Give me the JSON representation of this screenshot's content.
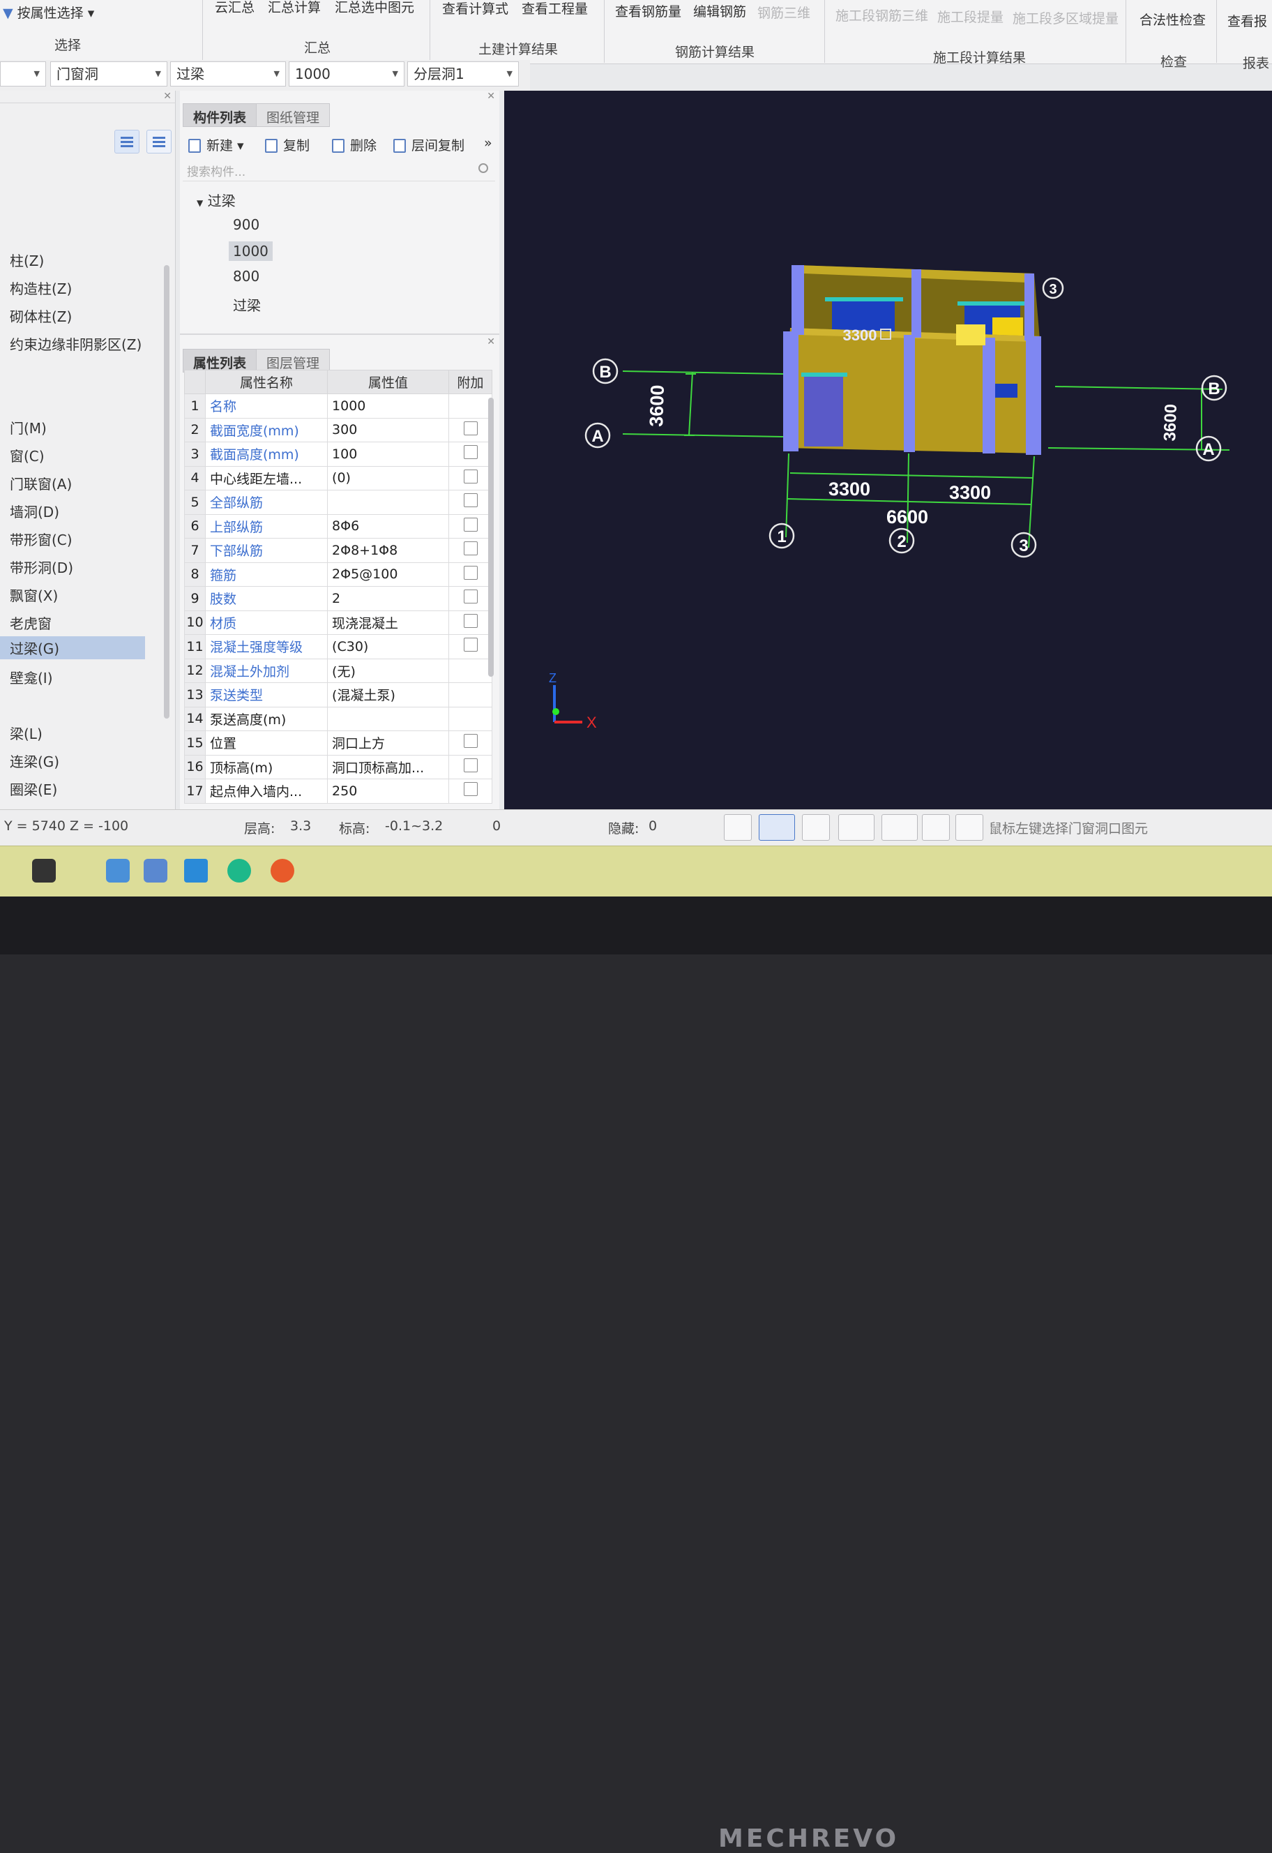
{
  "ribbon": {
    "select_by_attr": "按属性选择",
    "select_group": "选择",
    "cloud_summary": "云汇总",
    "summary_calc": "汇总计算",
    "summary_selected": "汇总选中图元",
    "summary_group": "汇总",
    "view_formula": "查看计算式",
    "view_quantity": "查看工程量",
    "civil_group": "土建计算结果",
    "view_rebar_qty": "查看钢筋量",
    "edit_rebar": "编辑钢筋",
    "rebar_3d": "钢筋三维",
    "rebar_group": "钢筋计算结果",
    "stage_rebar_3d": "施工段钢筋三维",
    "stage_qty": "施工段提量",
    "stage_multi_qty": "施工段多区域提量",
    "stage_group": "施工段计算结果",
    "legality_check": "合法性检查",
    "check_group": "检查",
    "view_report": "查看报",
    "report_group": "报表"
  },
  "filters": {
    "category": "门窗洞",
    "type": "过梁",
    "name": "1000",
    "floor": "分层洞1"
  },
  "left_tree": {
    "items": [
      "柱(Z)",
      "构造柱(Z)",
      "砌体柱(Z)",
      "约束边缘非阴影区(Z)",
      "门(M)",
      "窗(C)",
      "门联窗(A)",
      "墙洞(D)",
      "带形窗(C)",
      "带形洞(D)",
      "飘窗(X)",
      "老虎窗",
      "过梁(G)",
      "壁龛(I)",
      "梁(L)",
      "连梁(G)",
      "圈梁(E)"
    ],
    "selected": "过梁(G)"
  },
  "component_panel": {
    "tabs": [
      "构件列表",
      "图纸管理"
    ],
    "toolbar": {
      "new": "新建",
      "copy": "复制",
      "delete": "删除",
      "floor_copy": "层间复制"
    },
    "search_placeholder": "搜索构件...",
    "group": "过梁",
    "items": [
      "900",
      "1000",
      "800",
      "过梁"
    ],
    "selected": "1000"
  },
  "property_panel": {
    "tabs": [
      "属性列表",
      "图层管理"
    ],
    "headers": [
      "属性名称",
      "属性值",
      "附加"
    ],
    "rows": [
      {
        "n": "1",
        "name": "名称",
        "value": "1000",
        "blue": true,
        "check": false
      },
      {
        "n": "2",
        "name": "截面宽度(mm)",
        "value": "300",
        "blue": true,
        "check": true
      },
      {
        "n": "3",
        "name": "截面高度(mm)",
        "value": "100",
        "blue": true,
        "check": true
      },
      {
        "n": "4",
        "name": "中心线距左墙...",
        "value": "(0)",
        "blue": false,
        "check": true
      },
      {
        "n": "5",
        "name": "全部纵筋",
        "value": "",
        "blue": true,
        "check": true
      },
      {
        "n": "6",
        "name": "上部纵筋",
        "value": "8Φ6",
        "blue": true,
        "check": true
      },
      {
        "n": "7",
        "name": "下部纵筋",
        "value": "2Φ8+1Φ8",
        "blue": true,
        "check": true
      },
      {
        "n": "8",
        "name": "箍筋",
        "value": "2Φ5@100",
        "blue": true,
        "check": true
      },
      {
        "n": "9",
        "name": "肢数",
        "value": "2",
        "blue": true,
        "check": true
      },
      {
        "n": "10",
        "name": "材质",
        "value": "现浇混凝土",
        "blue": true,
        "check": true
      },
      {
        "n": "11",
        "name": "混凝土强度等级",
        "value": "(C30)",
        "blue": true,
        "check": true
      },
      {
        "n": "12",
        "name": "混凝土外加剂",
        "value": "(无)",
        "blue": true,
        "check": false
      },
      {
        "n": "13",
        "name": "泵送类型",
        "value": "(混凝土泵)",
        "blue": true,
        "check": false
      },
      {
        "n": "14",
        "name": "泵送高度(m)",
        "value": "",
        "blue": false,
        "check": false
      },
      {
        "n": "15",
        "name": "位置",
        "value": "洞口上方",
        "blue": false,
        "check": true
      },
      {
        "n": "16",
        "name": "顶标高(m)",
        "value": "洞口顶标高加...",
        "blue": false,
        "check": true
      },
      {
        "n": "17",
        "name": "起点伸入墙内...",
        "value": "250",
        "blue": false,
        "check": true
      }
    ]
  },
  "viewport": {
    "axis_labels": {
      "a": "A",
      "b": "B",
      "g1": "1",
      "g2": "2",
      "g3": "3"
    },
    "dims": {
      "bay1": "3300",
      "bay2": "3300",
      "total": "6600",
      "depth_left": "3600",
      "depth_right": "3600"
    },
    "window_label": "3300",
    "axis_x": "X",
    "axis_z": "Z"
  },
  "status_bar": {
    "coords": "Y = 5740 Z = -100",
    "floor_height_label": "层高:",
    "floor_height": "3.3",
    "elevation_label": "标高:",
    "elevation": "-0.1~3.2",
    "count": "0",
    "hidden_label": "隐藏:",
    "hidden": "0",
    "hint": "鼠标左键选择门窗洞口图元"
  },
  "monitor_brand": "MECHREVO",
  "colors": {
    "viewport_bg": "#1a1a2e",
    "wall": "#b59a1e",
    "column": "#7f87f2",
    "grid": "#3fd83f",
    "selected_bg": "#b9cbe6",
    "link_blue": "#3d6fcf"
  }
}
